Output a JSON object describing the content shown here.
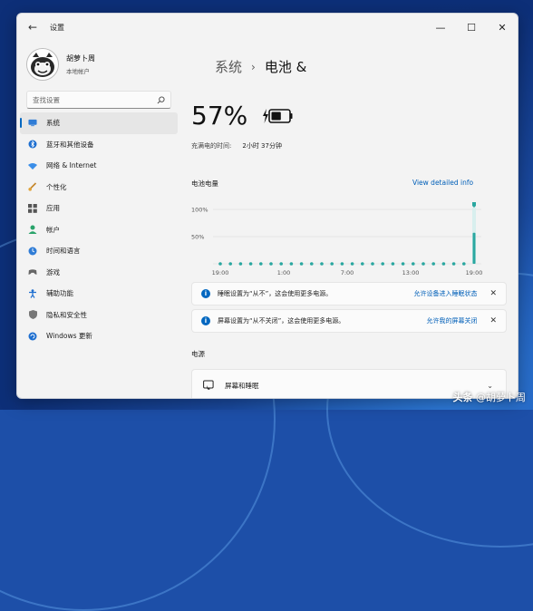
{
  "window": {
    "app_title": "设置",
    "back_icon": "←",
    "minimize_icon": "—",
    "maximize_icon": "☐",
    "close_icon": "✕"
  },
  "profile": {
    "name": "胡萝卜周",
    "account": "本地帐户"
  },
  "search": {
    "placeholder": "查找设置"
  },
  "sidebar": {
    "items": [
      {
        "label": "系统",
        "icon": "monitor-icon",
        "active": true
      },
      {
        "label": "蓝牙和其他设备",
        "icon": "bluetooth-icon"
      },
      {
        "label": "网络 & Internet",
        "icon": "wifi-icon"
      },
      {
        "label": "个性化",
        "icon": "brush-icon"
      },
      {
        "label": "应用",
        "icon": "apps-icon"
      },
      {
        "label": "帐户",
        "icon": "person-icon"
      },
      {
        "label": "时间和语言",
        "icon": "globe-clock-icon"
      },
      {
        "label": "游戏",
        "icon": "gamepad-icon"
      },
      {
        "label": "辅助功能",
        "icon": "accessibility-icon"
      },
      {
        "label": "隐私和安全性",
        "icon": "shield-icon"
      },
      {
        "label": "Windows 更新",
        "icon": "update-icon"
      }
    ]
  },
  "breadcrumb": {
    "parent": "系统",
    "separator": "›",
    "current": "电池 &"
  },
  "battery": {
    "percent": "57%",
    "charged_label": "充满电的时间:",
    "charged_value": "2小时 37分钟",
    "level": 0.57
  },
  "usage": {
    "title": "电池电量",
    "details_link": "View detailed info"
  },
  "chart_data": {
    "type": "bar",
    "title": "电池电量",
    "y_tick_labels": [
      "100%",
      "50%"
    ],
    "x_tick_labels": [
      "19:00",
      "1:00",
      "7:00",
      "13:00",
      "19:00"
    ],
    "ylim": [
      0,
      100
    ],
    "values": [
      0,
      0,
      0,
      0,
      0,
      0,
      0,
      0,
      0,
      0,
      0,
      0,
      0,
      0,
      0,
      0,
      0,
      0,
      0,
      0,
      0,
      0,
      0,
      0,
      0,
      57
    ],
    "accent": "#2aa7a0",
    "grid": true
  },
  "notices": [
    {
      "text": "睡眠设置为“从不”，这会使用更多电源。",
      "link": "允许设备进入睡眠状态",
      "close": "✕"
    },
    {
      "text": "屏幕设置为“从不关闭”，这会使用更多电源。",
      "link": "允许我的屏幕关闭",
      "close": "✕"
    }
  ],
  "power": {
    "section_title": "电源",
    "screen_sleep_label": "屏幕和睡眠",
    "chevron": "⌄"
  },
  "watermark": {
    "brand": "头条",
    "handle": "@胡萝卜周"
  },
  "colors": {
    "accent": "#0067c0",
    "chart": "#2aa7a0",
    "link": "#005fb8"
  }
}
